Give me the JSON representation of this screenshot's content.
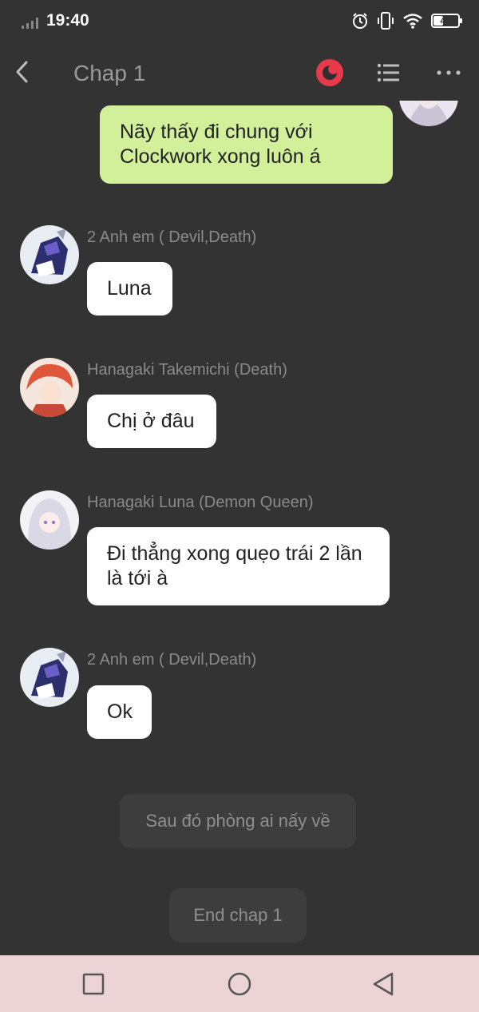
{
  "status_bar": {
    "time": "19:40",
    "battery": "44",
    "battery_level_percent": 44,
    "icons": [
      "signal-icon",
      "alarm-icon",
      "vibrate-icon",
      "wifi-icon",
      "battery-icon"
    ]
  },
  "header": {
    "title": "Chap 1",
    "icons": [
      "back-arrow-icon",
      "record-icon",
      "list-icon",
      "more-icon"
    ],
    "accent_color": "#e83a4a"
  },
  "messages": [
    {
      "side": "self",
      "text": "Nãy thấy đi chung với Clockwork xong luôn á",
      "bubble_color": "#d2ef9a"
    },
    {
      "side": "other",
      "sender": "2 Anh em ( Devil,Death)",
      "text": "Luna"
    },
    {
      "side": "other",
      "sender": "Hanagaki Takemichi (Death)",
      "text": "Chị ở đâu"
    },
    {
      "side": "other",
      "sender": "Hanagaki Luna (Demon Queen)",
      "text": "Đi thẳng xong quẹo trái 2 lần là tới à"
    },
    {
      "side": "other",
      "sender": "2 Anh em ( Devil,Death)",
      "text": "Ok"
    }
  ],
  "narrations": [
    "Sau đó phòng ai nấy về",
    "End chap 1"
  ],
  "nav_bar": {
    "icons": [
      "recents-square-icon",
      "home-circle-icon",
      "back-triangle-icon"
    ],
    "background": "#ecd3d6"
  }
}
